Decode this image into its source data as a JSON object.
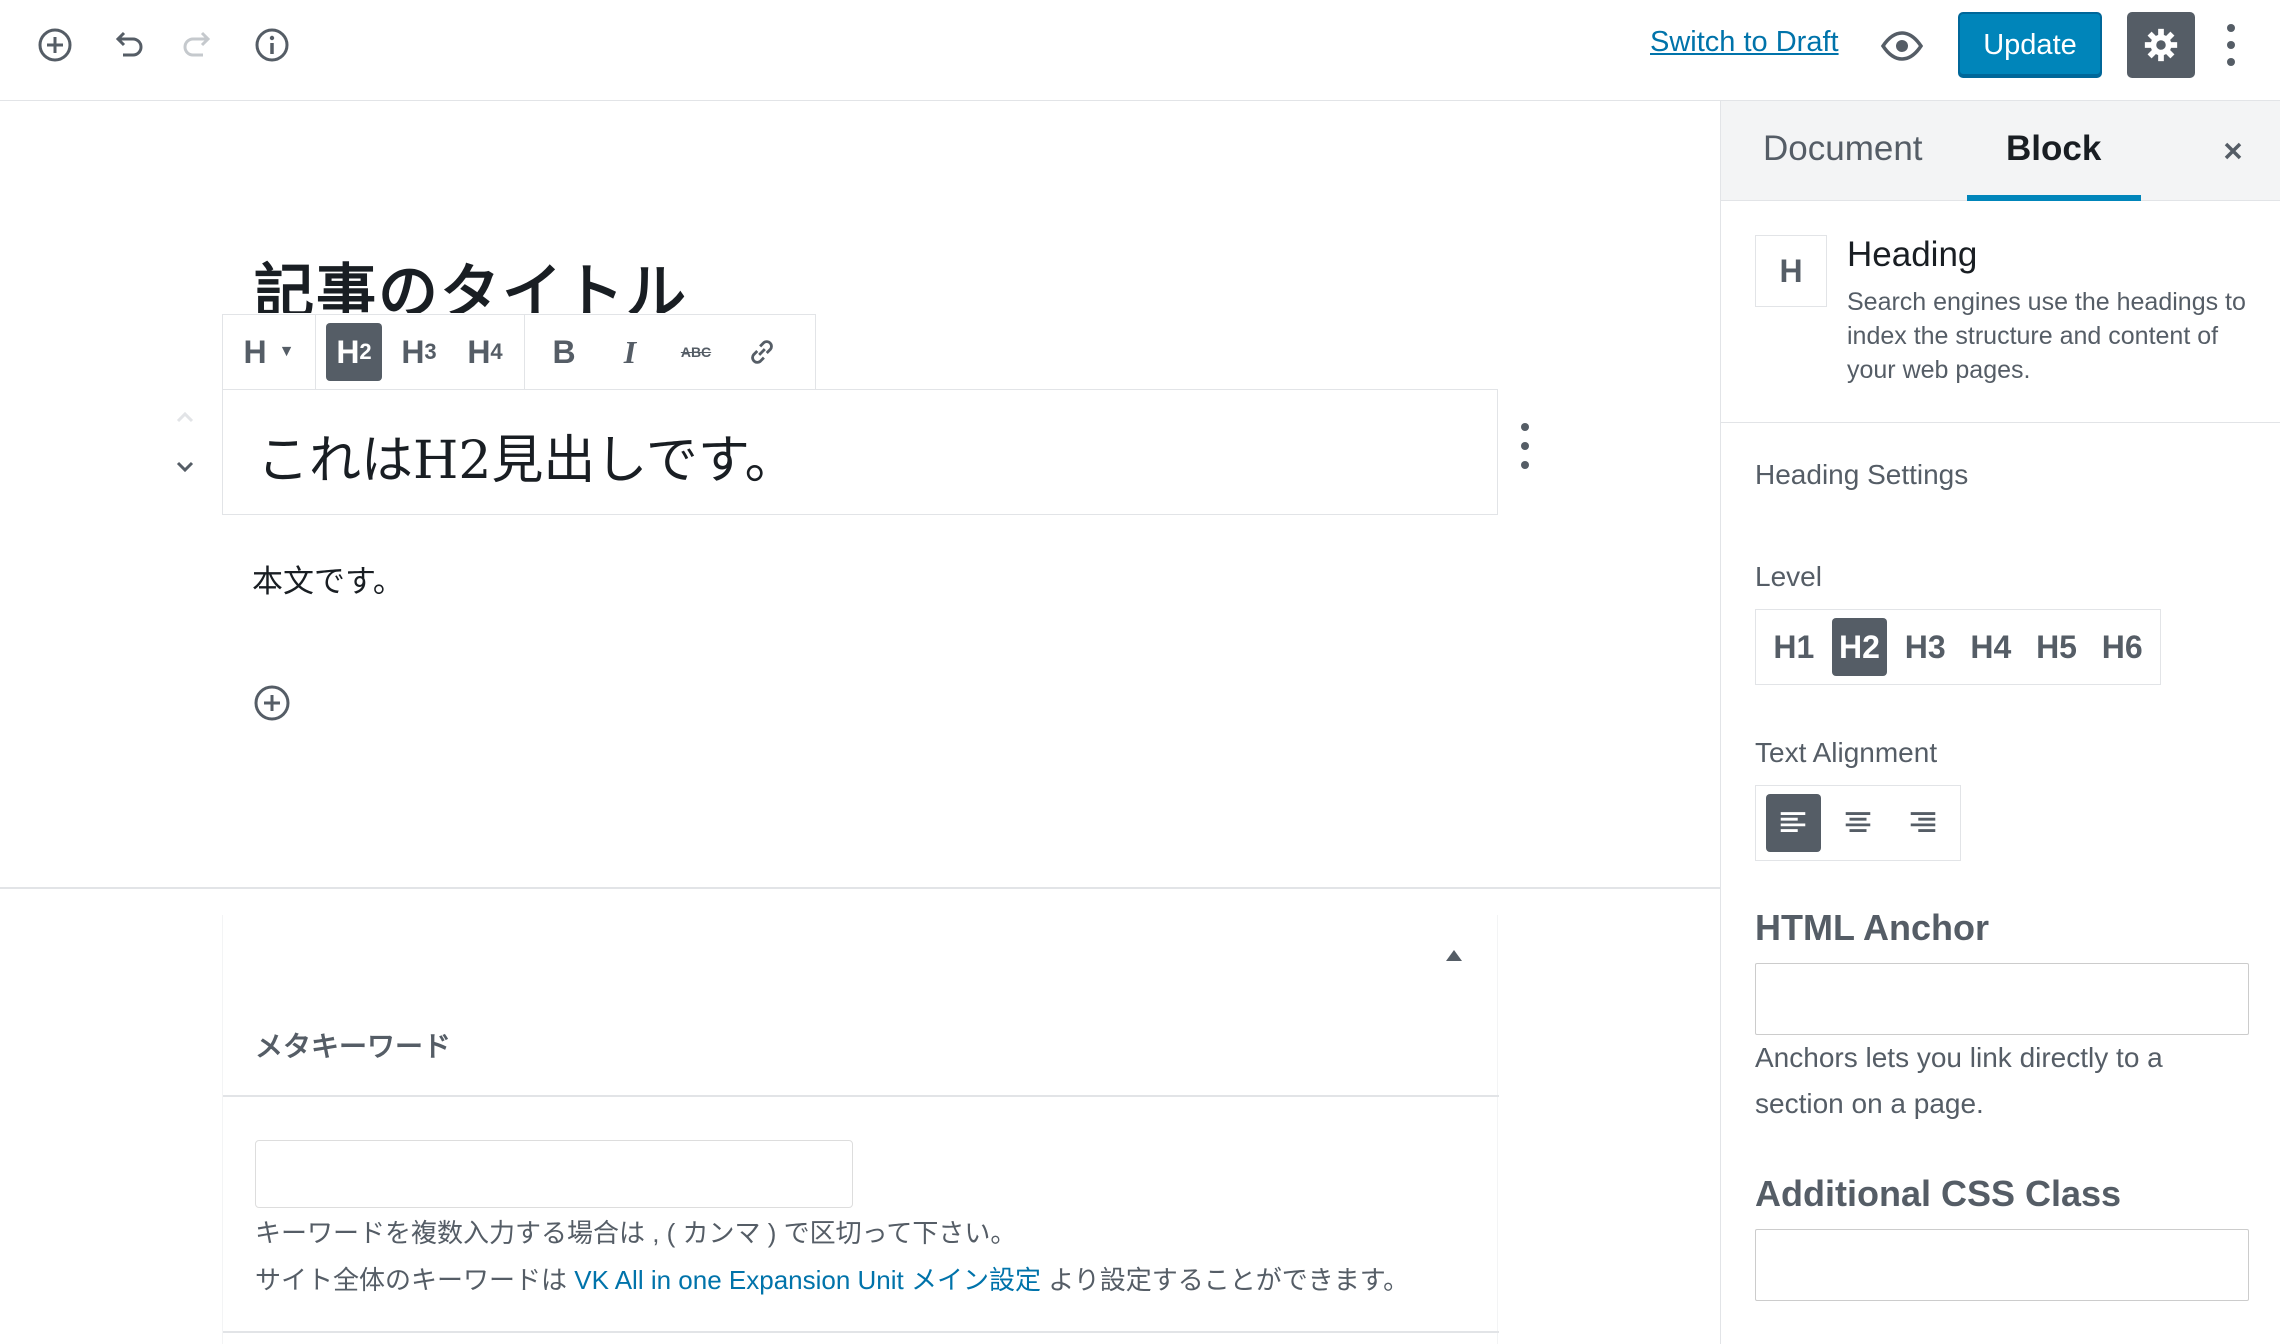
{
  "toolbar": {
    "switch_to_draft": "Switch to Draft",
    "update": "Update"
  },
  "editor": {
    "post_title": "記事のタイトル",
    "heading_text": "これはH2見出しです。",
    "paragraph_text": "本文です。",
    "block_toolbar": {
      "heading_switcher": "H",
      "levels": [
        "H2",
        "H3",
        "H4"
      ],
      "active_level": "H2",
      "bold": "B",
      "italic": "I",
      "strikethrough": "ABC"
    }
  },
  "metabox": {
    "heading": "メタキーワード",
    "keywords_value": "",
    "help_line1": "キーワードを複数入力する場合は , ( カンマ ) で区切って下さい。",
    "help_line2_prefix": "サイト全体のキーワードは ",
    "help_line2_link": "VK All in one Expansion Unit メイン設定",
    "help_line2_suffix": " より設定することができます。"
  },
  "sidebar": {
    "tabs": [
      {
        "label": "Document",
        "active": false
      },
      {
        "label": "Block",
        "active": true
      }
    ],
    "block": {
      "icon_label": "H",
      "title": "Heading",
      "description": "Search engines use the headings to index the structure and content of your web pages."
    },
    "heading_settings": "Heading Settings",
    "level_label": "Level",
    "levels": [
      "H1",
      "H2",
      "H3",
      "H4",
      "H5",
      "H6"
    ],
    "active_level": "H2",
    "text_alignment_label": "Text Alignment",
    "alignment_active": "left",
    "html_anchor_label": "HTML Anchor",
    "html_anchor_value": "",
    "anchor_help": "Anchors lets you link directly to a section on a page.",
    "css_class_label": "Additional CSS Class",
    "css_class_value": ""
  },
  "colors": {
    "accent": "#0085ba",
    "link": "#0073aa",
    "active_button": "#555d66",
    "border": "#e2e4e7"
  },
  "icons": {
    "top_left": [
      "add-block-icon",
      "undo-icon",
      "redo-icon",
      "info-icon"
    ],
    "top_right": [
      "preview-eye-icon",
      "settings-gear-icon",
      "more-vertical-icon"
    ]
  }
}
